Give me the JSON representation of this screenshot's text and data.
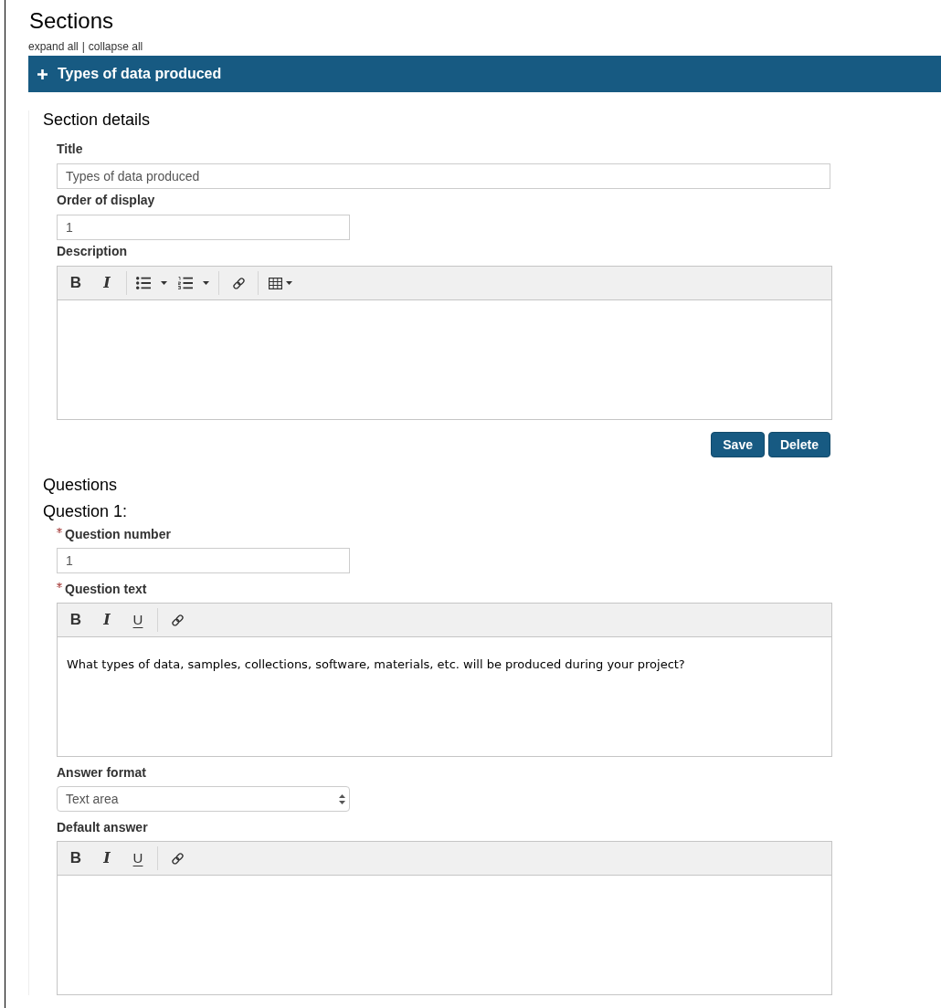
{
  "page": {
    "title": "Sections",
    "links": [
      {
        "label": "expand all"
      },
      {
        "label": "collapse all"
      }
    ],
    "link_separator": "|"
  },
  "section": {
    "title": "Types of data produced",
    "details": {
      "heading": "Section details",
      "fields": [
        {
          "kind": "text",
          "label": "Title",
          "required": false,
          "value": "Types of data produced"
        },
        {
          "kind": "number",
          "label": "Order of display",
          "required": false,
          "value": "1"
        },
        {
          "kind": "editor",
          "label": "Description",
          "required": false,
          "toolbar": [
            {
              "tools": [
                {
                  "kind": "bold",
                  "label": "B",
                  "dropdown": false
                },
                {
                  "kind": "italic",
                  "label": "I",
                  "dropdown": false
                }
              ]
            },
            {
              "tools": [
                {
                  "kind": "bullet-list",
                  "dropdown": true
                },
                {
                  "kind": "numbered-list",
                  "dropdown": true
                }
              ]
            },
            {
              "tools": [
                {
                  "kind": "link",
                  "dropdown": false
                }
              ]
            },
            {
              "tools": [
                {
                  "kind": "table",
                  "dropdown": true
                }
              ]
            }
          ]
        }
      ],
      "buttons": [
        {
          "label": "Save"
        },
        {
          "label": "Delete"
        }
      ]
    },
    "questions": {
      "heading": "Questions",
      "items": [
        {
          "title": "Question 1:",
          "fields": [
            {
              "kind": "number",
              "label": "Question number",
              "required": true,
              "value": "1"
            },
            {
              "kind": "editor",
              "label": "Question text",
              "required": true,
              "toolbar": [
                {
                  "tools": [
                    {
                      "kind": "bold",
                      "label": "B",
                      "dropdown": false
                    },
                    {
                      "kind": "italic",
                      "label": "I",
                      "dropdown": false
                    },
                    {
                      "kind": "underline",
                      "label": "U",
                      "dropdown": false
                    }
                  ]
                },
                {
                  "tools": [
                    {
                      "kind": "link",
                      "dropdown": false
                    }
                  ]
                }
              ],
              "content": "What types of data, samples, collections, software, materials, etc. will be produced during your project?"
            },
            {
              "kind": "select",
              "label": "Answer format",
              "required": false,
              "value": "Text area"
            },
            {
              "kind": "editor",
              "label": "Default answer",
              "required": false,
              "toolbar": [
                {
                  "tools": [
                    {
                      "kind": "bold",
                      "label": "B",
                      "dropdown": false
                    },
                    {
                      "kind": "italic",
                      "label": "I",
                      "dropdown": false
                    },
                    {
                      "kind": "underline",
                      "label": "U",
                      "dropdown": false
                    }
                  ]
                },
                {
                  "tools": [
                    {
                      "kind": "link",
                      "dropdown": false
                    }
                  ]
                }
              ]
            }
          ]
        }
      ]
    }
  }
}
